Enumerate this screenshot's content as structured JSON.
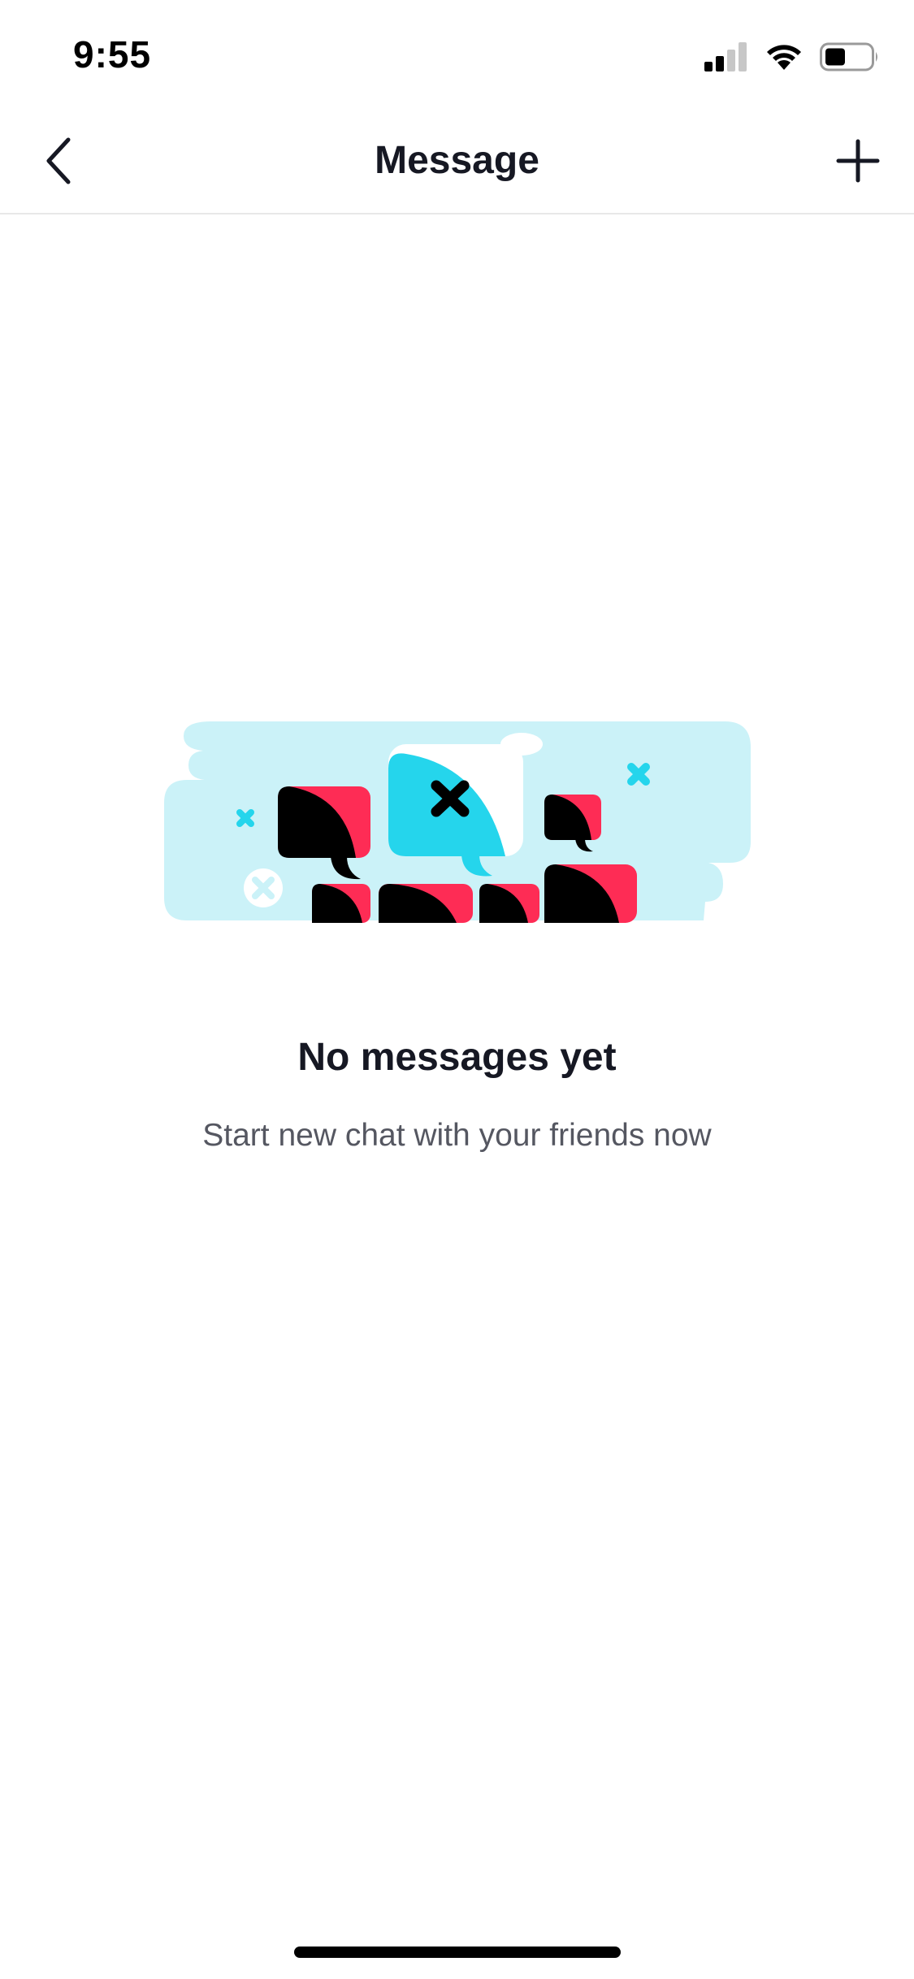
{
  "status_bar": {
    "time": "9:55",
    "icons": [
      "cellular-signal-icon",
      "wifi-icon",
      "battery-icon"
    ]
  },
  "nav": {
    "title": "Message",
    "back_icon": "chevron-left-icon",
    "add_icon": "plus-icon"
  },
  "empty_state": {
    "title": "No messages yet",
    "subtitle": "Start new chat with your friends now"
  },
  "colors": {
    "accent_red": "#FE2C55",
    "accent_cyan": "#25D5EC",
    "illustration_bg": "#CBF2F8",
    "text_primary": "#161823",
    "text_secondary": "#555761"
  }
}
